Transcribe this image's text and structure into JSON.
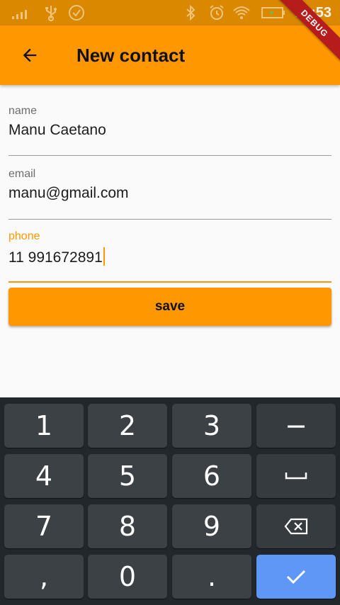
{
  "status_bar": {
    "time": "12:53",
    "icons": [
      "signal-icon",
      "usb-icon",
      "check-circle-icon",
      "bluetooth-icon",
      "alarm-icon",
      "wifi-icon",
      "battery-icon"
    ],
    "background": "#d98800"
  },
  "debug_banner": {
    "label": "DEBUG",
    "color": "#b71c1c"
  },
  "app_bar": {
    "title": "New contact",
    "back_icon": "arrow-back-icon",
    "background": "#ff9800"
  },
  "form": {
    "name": {
      "label": "name",
      "value": "Manu Caetano"
    },
    "email": {
      "label": "email",
      "value": "manu@gmail.com"
    },
    "phone": {
      "label": "phone",
      "value": "11 991672891",
      "focused": true
    }
  },
  "save_button": {
    "label": "save"
  },
  "keyboard": {
    "rows": [
      [
        "1",
        "2",
        "3",
        "−"
      ],
      [
        "4",
        "5",
        "6",
        "space"
      ],
      [
        "7",
        "8",
        "9",
        "backspace"
      ],
      [
        ",",
        "0",
        ".",
        "done"
      ]
    ],
    "accent": "#5e97f6"
  },
  "colors": {
    "primary": "#ff9800",
    "background": "#fafafa",
    "keyboard": "#22272b"
  }
}
